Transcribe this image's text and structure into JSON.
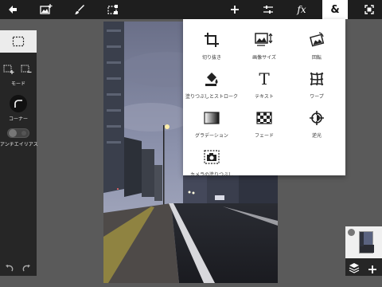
{
  "toolbar": {
    "icons": [
      "back-arrow-icon",
      "image-add-icon",
      "brush-icon",
      "transform-select-icon",
      "plus-icon",
      "adjustments-icon",
      "fx-icon",
      "ampersand-icon",
      "fullscreen-icon"
    ],
    "fx_label": "fx",
    "amp_label": "&",
    "active_color": "#ffffff"
  },
  "left_panel": {
    "mode_label": "モード",
    "corner_label": "コーナー",
    "antialias_label": "アンチエイリアス"
  },
  "tools_menu": {
    "items": [
      {
        "label": "切り抜き",
        "icon": "crop-icon"
      },
      {
        "label": "画像サイズ",
        "icon": "image-size-icon"
      },
      {
        "label": "回転",
        "icon": "rotate-icon"
      },
      {
        "label": "塗りつぶしとストローク",
        "icon": "fill-stroke-icon"
      },
      {
        "label": "テキスト",
        "icon": "text-icon"
      },
      {
        "label": "ワープ",
        "icon": "warp-icon"
      },
      {
        "label": "グラデーション",
        "icon": "gradient-icon"
      },
      {
        "label": "フェード",
        "icon": "fade-icon"
      },
      {
        "label": "逆光",
        "icon": "backlight-icon"
      },
      {
        "label": "カメラの塗りつぶし",
        "icon": "camera-fill-icon"
      }
    ],
    "text_glyph": "T"
  },
  "layers": {
    "icons": [
      "layers-icon",
      "add-layer-icon"
    ]
  },
  "colors": {
    "toolbar_bg": "#1e1e1e",
    "panel_bg": "#262626",
    "workspace_bg": "#5a5a5a"
  }
}
